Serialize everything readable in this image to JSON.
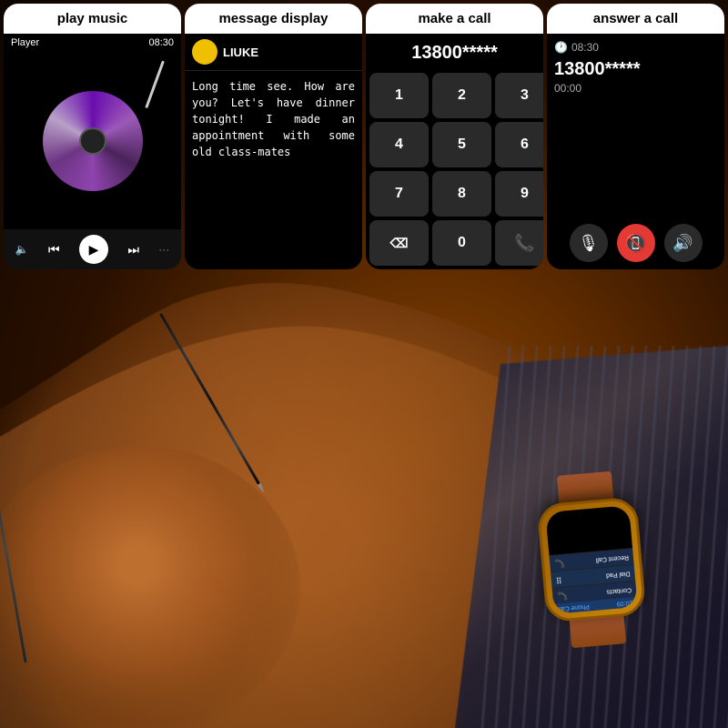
{
  "panels": {
    "music": {
      "header": "play music",
      "player_label": "Player",
      "time": "08:30"
    },
    "message": {
      "header": "message display",
      "sender": "LIUKE",
      "text": "Long time see. How are you? Let's have dinner tonight! I made an appointment with some old class-mates"
    },
    "dial": {
      "header": "make a call",
      "number": "13800*****",
      "keys": [
        "1",
        "2",
        "3",
        "4",
        "5",
        "6",
        "7",
        "8",
        "9",
        "⌫",
        "0",
        "📞"
      ]
    },
    "answer": {
      "header": "answer a call",
      "time": "08:30",
      "number": "13800*****",
      "duration": "00:00"
    }
  },
  "watch": {
    "time": "10:09",
    "label": "Phone Call",
    "menu": [
      {
        "label": "Contacts",
        "icon": "📞"
      },
      {
        "label": "Dial Pad",
        "icon": "⠿"
      },
      {
        "label": "Recent Call",
        "icon": "📞"
      }
    ]
  }
}
